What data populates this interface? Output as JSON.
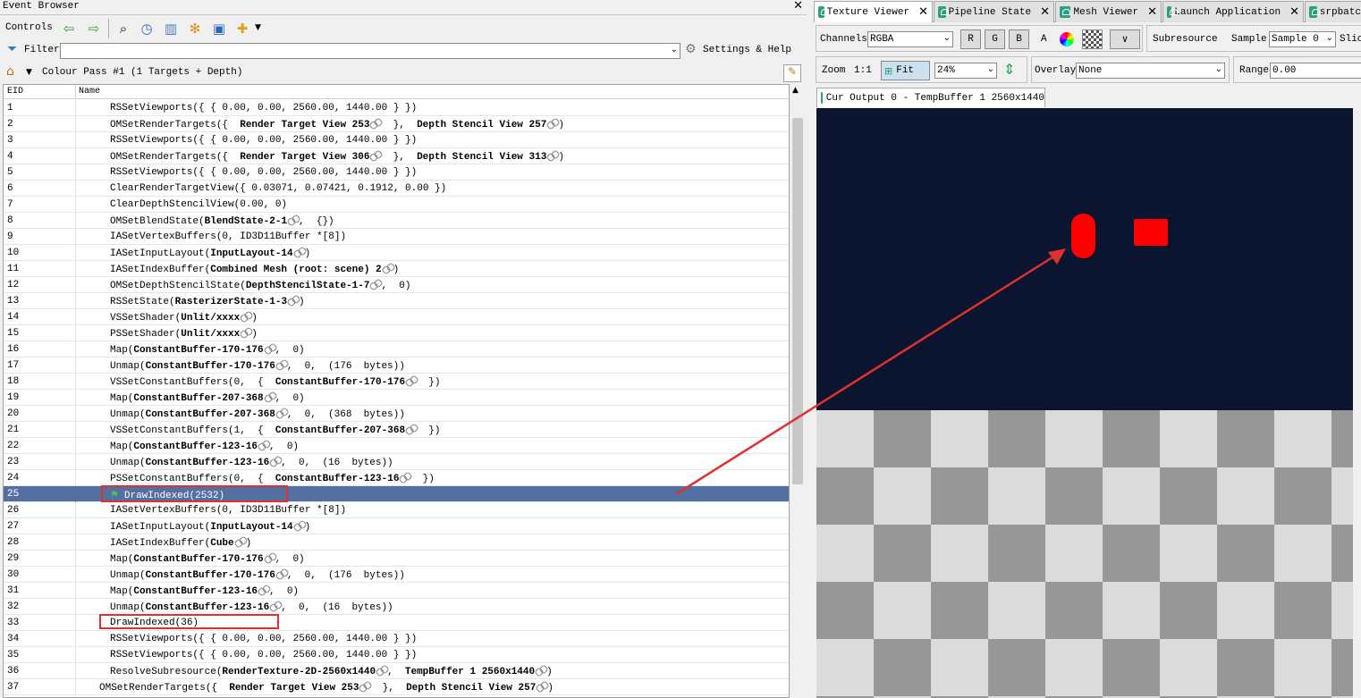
{
  "event_browser": {
    "title": "Event Browser",
    "controls_label": "Controls",
    "filter_label": "Filter",
    "filter_value": "",
    "settings_label": "Settings & Help",
    "breadcrumb": "Colour Pass #1 (1 Targets + Depth)",
    "col_eid": "EID",
    "col_name": "Name",
    "rows": [
      {
        "eid": "1",
        "indent": 2,
        "parts": [
          [
            "RSSetViewports({ { 0.00, 0.00, 2560.00, 1440.00 } })",
            0
          ]
        ]
      },
      {
        "eid": "2",
        "indent": 2,
        "parts": [
          [
            "OMSetRenderTargets({  ",
            0
          ],
          [
            "Render Target View 253",
            1
          ],
          [
            "  },  ",
            0
          ],
          [
            "Depth Stencil View 257",
            1
          ],
          [
            ")",
            0
          ]
        ],
        "links": [
          1,
          3
        ]
      },
      {
        "eid": "3",
        "indent": 2,
        "parts": [
          [
            "RSSetViewports({ { 0.00, 0.00, 2560.00, 1440.00 } })",
            0
          ]
        ]
      },
      {
        "eid": "4",
        "indent": 2,
        "parts": [
          [
            "OMSetRenderTargets({  ",
            0
          ],
          [
            "Render Target View 306",
            1
          ],
          [
            "  },  ",
            0
          ],
          [
            "Depth Stencil View 313",
            1
          ],
          [
            ")",
            0
          ]
        ],
        "links": [
          1,
          3
        ]
      },
      {
        "eid": "5",
        "indent": 2,
        "parts": [
          [
            "RSSetViewports({ { 0.00, 0.00, 2560.00, 1440.00 } })",
            0
          ]
        ]
      },
      {
        "eid": "6",
        "indent": 2,
        "parts": [
          [
            "ClearRenderTargetView({ 0.03071, 0.07421, 0.1912, 0.00 })",
            0
          ]
        ]
      },
      {
        "eid": "7",
        "indent": 2,
        "parts": [
          [
            "ClearDepthStencilView(0.00, 0)",
            0
          ]
        ]
      },
      {
        "eid": "8",
        "indent": 2,
        "parts": [
          [
            "OMSetBlendState(",
            0
          ],
          [
            "BlendState-2-1",
            1
          ],
          [
            ",  {})",
            0
          ]
        ],
        "links": [
          1
        ]
      },
      {
        "eid": "9",
        "indent": 2,
        "parts": [
          [
            "IASetVertexBuffers(0, ID3D11Buffer *[8])",
            0
          ]
        ]
      },
      {
        "eid": "10",
        "indent": 2,
        "parts": [
          [
            "IASetInputLayout(",
            0
          ],
          [
            "InputLayout-14",
            1
          ],
          [
            ")",
            0
          ]
        ],
        "links": [
          1
        ]
      },
      {
        "eid": "11",
        "indent": 2,
        "parts": [
          [
            "IASetIndexBuffer(",
            0
          ],
          [
            "Combined Mesh (root: scene) 2",
            1
          ],
          [
            ")",
            0
          ]
        ],
        "links": [
          1
        ]
      },
      {
        "eid": "12",
        "indent": 2,
        "parts": [
          [
            "OMSetDepthStencilState(",
            0
          ],
          [
            "DepthStencilState-1-7",
            1
          ],
          [
            ",  0)",
            0
          ]
        ],
        "links": [
          1
        ]
      },
      {
        "eid": "13",
        "indent": 2,
        "parts": [
          [
            "RSSetState(",
            0
          ],
          [
            "RasterizerState-1-3",
            1
          ],
          [
            ")",
            0
          ]
        ],
        "links": [
          1
        ]
      },
      {
        "eid": "14",
        "indent": 2,
        "parts": [
          [
            "VSSetShader(",
            0
          ],
          [
            "Unlit/xxxx",
            1
          ],
          [
            ")",
            0
          ]
        ],
        "links": [
          1
        ]
      },
      {
        "eid": "15",
        "indent": 2,
        "parts": [
          [
            "PSSetShader(",
            0
          ],
          [
            "Unlit/xxxx",
            1
          ],
          [
            ")",
            0
          ]
        ],
        "links": [
          1
        ]
      },
      {
        "eid": "16",
        "indent": 2,
        "parts": [
          [
            "Map(",
            0
          ],
          [
            "ConstantBuffer-170-176",
            1
          ],
          [
            ",  0)",
            0
          ]
        ],
        "links": [
          1
        ]
      },
      {
        "eid": "17",
        "indent": 2,
        "parts": [
          [
            "Unmap(",
            0
          ],
          [
            "ConstantBuffer-170-176",
            1
          ],
          [
            ",  0,  (176  bytes))",
            0
          ]
        ],
        "links": [
          1
        ]
      },
      {
        "eid": "18",
        "indent": 2,
        "parts": [
          [
            "VSSetConstantBuffers(0,  {  ",
            0
          ],
          [
            "ConstantBuffer-170-176",
            1
          ],
          [
            "  })",
            0
          ]
        ],
        "links": [
          1
        ]
      },
      {
        "eid": "19",
        "indent": 2,
        "parts": [
          [
            "Map(",
            0
          ],
          [
            "ConstantBuffer-207-368",
            1
          ],
          [
            ",  0)",
            0
          ]
        ],
        "links": [
          1
        ]
      },
      {
        "eid": "20",
        "indent": 2,
        "parts": [
          [
            "Unmap(",
            0
          ],
          [
            "ConstantBuffer-207-368",
            1
          ],
          [
            ",  0,  (368  bytes))",
            0
          ]
        ],
        "links": [
          1
        ]
      },
      {
        "eid": "21",
        "indent": 2,
        "parts": [
          [
            "VSSetConstantBuffers(1,  {  ",
            0
          ],
          [
            "ConstantBuffer-207-368",
            1
          ],
          [
            "  })",
            0
          ]
        ],
        "links": [
          1
        ]
      },
      {
        "eid": "22",
        "indent": 2,
        "parts": [
          [
            "Map(",
            0
          ],
          [
            "ConstantBuffer-123-16",
            1
          ],
          [
            ",  0)",
            0
          ]
        ],
        "links": [
          1
        ]
      },
      {
        "eid": "23",
        "indent": 2,
        "parts": [
          [
            "Unmap(",
            0
          ],
          [
            "ConstantBuffer-123-16",
            1
          ],
          [
            ",  0,  (16  bytes))",
            0
          ]
        ],
        "links": [
          1
        ]
      },
      {
        "eid": "24",
        "indent": 2,
        "parts": [
          [
            "PSSetConstantBuffers(0,  {  ",
            0
          ],
          [
            "ConstantBuffer-123-16",
            1
          ],
          [
            "  })",
            0
          ]
        ],
        "links": [
          1
        ]
      },
      {
        "eid": "25",
        "indent": 3,
        "flag": true,
        "selected": true,
        "parts": [
          [
            "DrawIndexed(2532)",
            0
          ]
        ]
      },
      {
        "eid": "26",
        "indent": 2,
        "parts": [
          [
            "IASetVertexBuffers(0, ID3D11Buffer *[8])",
            0
          ]
        ]
      },
      {
        "eid": "27",
        "indent": 2,
        "parts": [
          [
            "IASetInputLayout(",
            0
          ],
          [
            "InputLayout-14",
            1
          ],
          [
            ")",
            0
          ]
        ],
        "links": [
          1
        ]
      },
      {
        "eid": "28",
        "indent": 2,
        "parts": [
          [
            "IASetIndexBuffer(",
            0
          ],
          [
            "Cube",
            1
          ],
          [
            ")",
            0
          ]
        ],
        "links": [
          1
        ]
      },
      {
        "eid": "29",
        "indent": 2,
        "parts": [
          [
            "Map(",
            0
          ],
          [
            "ConstantBuffer-170-176",
            1
          ],
          [
            ",  0)",
            0
          ]
        ],
        "links": [
          1
        ]
      },
      {
        "eid": "30",
        "indent": 2,
        "parts": [
          [
            "Unmap(",
            0
          ],
          [
            "ConstantBuffer-170-176",
            1
          ],
          [
            ",  0,  (176  bytes))",
            0
          ]
        ],
        "links": [
          1
        ]
      },
      {
        "eid": "31",
        "indent": 2,
        "parts": [
          [
            "Map(",
            0
          ],
          [
            "ConstantBuffer-123-16",
            1
          ],
          [
            ",  0)",
            0
          ]
        ],
        "links": [
          1
        ]
      },
      {
        "eid": "32",
        "indent": 2,
        "parts": [
          [
            "Unmap(",
            0
          ],
          [
            "ConstantBuffer-123-16",
            1
          ],
          [
            ",  0,  (16  bytes))",
            0
          ]
        ],
        "links": [
          1
        ]
      },
      {
        "eid": "33",
        "indent": 2,
        "parts": [
          [
            "DrawIndexed(36)",
            0
          ]
        ]
      },
      {
        "eid": "34",
        "indent": 2,
        "parts": [
          [
            "RSSetViewports({ { 0.00, 0.00, 2560.00, 1440.00 } })",
            0
          ]
        ]
      },
      {
        "eid": "35",
        "indent": 2,
        "parts": [
          [
            "RSSetViewports({ { 0.00, 0.00, 2560.00, 1440.00 } })",
            0
          ]
        ]
      },
      {
        "eid": "36",
        "indent": 2,
        "parts": [
          [
            "ResolveSubresource(",
            0
          ],
          [
            "RenderTexture-2D-2560x1440",
            1
          ],
          [
            ",  ",
            0
          ],
          [
            "TempBuffer 1 2560x1440",
            1
          ],
          [
            ")",
            0
          ]
        ],
        "links": [
          1,
          3
        ]
      },
      {
        "eid": "37",
        "indent": 1,
        "parts": [
          [
            "OMSetRenderTargets({  ",
            0
          ],
          [
            "Render Target View 253",
            1
          ],
          [
            "  },  ",
            0
          ],
          [
            "Depth Stencil View 257",
            1
          ],
          [
            ")",
            0
          ]
        ],
        "links": [
          1,
          3
        ]
      },
      {
        "eid": "",
        "indent": 2,
        "parts": [
          [
            "                  ({",
            0
          ]
        ]
      }
    ]
  },
  "tabs": [
    {
      "label": "Texture Viewer",
      "active": true
    },
    {
      "label": "Pipeline State",
      "active": false
    },
    {
      "label": "Mesh Viewer",
      "active": false
    },
    {
      "label": "Launch Application",
      "active": false
    },
    {
      "label": "srpbatc",
      "active": false
    }
  ],
  "texture_viewer": {
    "channels_label": "Channels",
    "channels_value": "RGBA",
    "toggle_r": "R",
    "toggle_g": "G",
    "toggle_b": "B",
    "toggle_a": "A",
    "subresource_label": "Subresource",
    "sample_label": "Sample",
    "sample_value": "Sample 0",
    "slice_label": "Slic",
    "zoom_label": "Zoom",
    "zoom_1to1": "1:1",
    "fit_label": "Fit",
    "zoom_value": "24%",
    "overlay_label": "Overlay",
    "overlay_value": "None",
    "range_label": "Range",
    "range_value": "0.00",
    "output_tab": "Cur Output 0 - TempBuffer 1 2560x1440"
  },
  "colors": {
    "selection": "#5470a0",
    "render_bg": "#0b1530",
    "object": "#ff0000",
    "annotation": "#e03030"
  }
}
